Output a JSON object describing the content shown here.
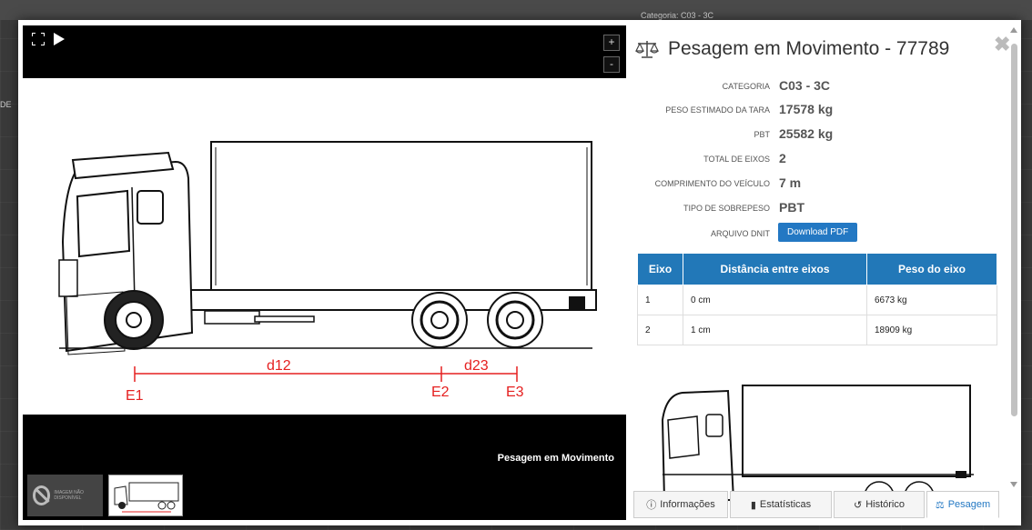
{
  "background": {
    "category_text": "Categoria: C03 - 3C",
    "left_fragment": "DE"
  },
  "viewer": {
    "zoom_in": "+",
    "zoom_out": "-",
    "caption": "Pesagem em Movimento",
    "diagram_labels": {
      "d12": "d12",
      "d23": "d23",
      "e1": "E1",
      "e2": "E2",
      "e3": "E3"
    },
    "thumbnail_na_text": "IMAGEM NÃO DISPONÍVEL"
  },
  "panel": {
    "title": "Pesagem em Movimento - 77789",
    "fields": [
      {
        "label": "CATEGORIA",
        "value": "C03 - 3C"
      },
      {
        "label": "PESO ESTIMADO DA TARA",
        "value": "17578 kg"
      },
      {
        "label": "PBT",
        "value": "25582 kg"
      },
      {
        "label": "TOTAL DE EIXOS",
        "value": "2"
      },
      {
        "label": "COMPRIMENTO DO VEÍCULO",
        "value": "7 m"
      },
      {
        "label": "TIPO DE SOBREPESO",
        "value": "PBT"
      },
      {
        "label": "ARQUIVO DNIT",
        "value": ""
      }
    ],
    "download_label": "Download PDF",
    "table": {
      "headers": [
        "Eixo",
        "Distância entre eixos",
        "Peso do eixo"
      ],
      "rows": [
        [
          "1",
          "0 cm",
          "6673 kg"
        ],
        [
          "2",
          "1 cm",
          "18909 kg"
        ]
      ]
    },
    "tabs": [
      {
        "label": "Informações",
        "icon": "info-icon"
      },
      {
        "label": "Estatísticas",
        "icon": "bar-chart-icon"
      },
      {
        "label": "Histórico",
        "icon": "history-icon"
      },
      {
        "label": "Pesagem",
        "icon": "scale-icon",
        "active": true
      }
    ]
  },
  "colors": {
    "accent": "#2378c3",
    "table_header": "#2278b8",
    "diagram_red": "#e52020"
  }
}
